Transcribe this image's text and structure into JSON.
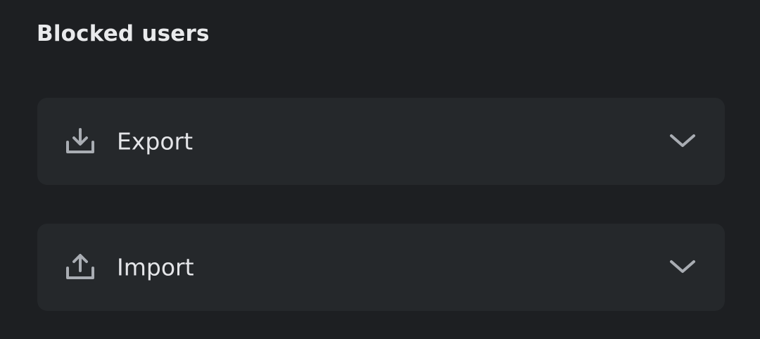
{
  "section": {
    "title": "Blocked users"
  },
  "rows": [
    {
      "label": "Export",
      "icon": "download-icon"
    },
    {
      "label": "Import",
      "icon": "upload-icon"
    }
  ],
  "colors": {
    "background": "#1d1f22",
    "row_background": "#25282b",
    "text": "#e4e5e8",
    "icon": "#a9adb3"
  }
}
